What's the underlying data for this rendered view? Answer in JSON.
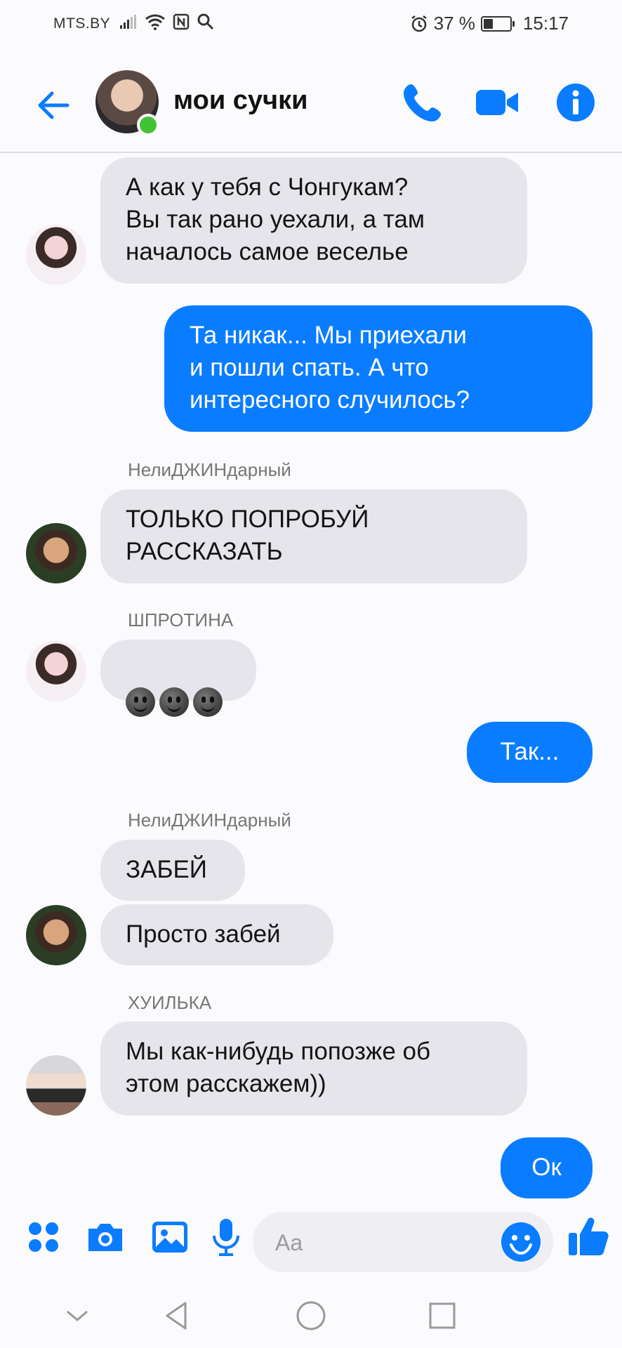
{
  "status_bar": {
    "carrier": "MTS.BY",
    "battery_percent": "37 %",
    "battery_level": 0.37,
    "time": "15:17"
  },
  "header": {
    "title": "мои сучки",
    "back_icon": "back-arrow-icon",
    "call_icon": "phone-icon",
    "video_icon": "video-camera-icon",
    "info_icon": "info-icon"
  },
  "messages": [
    {
      "direction": "in",
      "sender": "",
      "text": "А как у тебя с Чонгукам?\nВы так рано уехали, а там\nначалось самое веселье"
    },
    {
      "direction": "out",
      "text": "Та никак... Мы приехали\nи пошли спать. А что\nинтересного случилось?"
    },
    {
      "direction": "in",
      "sender": "НелиДЖИНдарный",
      "text": "ТОЛЬКО ПОПРОБУЙ\nРАССКАЗАТЬ"
    },
    {
      "direction": "in",
      "sender": "ШПРОТИНА",
      "text": "",
      "emoji": "grinning-face-emoji x3"
    },
    {
      "direction": "out",
      "text": "Так..."
    },
    {
      "direction": "in",
      "sender": "НелиДЖИНдарный",
      "text": "ЗАБЕЙ"
    },
    {
      "direction": "in",
      "sender": "",
      "text": "Просто забей"
    },
    {
      "direction": "in",
      "sender": "ХУИЛЬКА",
      "text": "Мы как-нибудь попозже об\nэтом расскажем))"
    },
    {
      "direction": "out",
      "text": "Ок"
    }
  ],
  "composer": {
    "placeholder": "Aa",
    "icons": [
      "more-apps-icon",
      "camera-icon",
      "gallery-icon",
      "microphone-icon",
      "emoji-icon",
      "thumbs-up-icon"
    ]
  },
  "colors": {
    "accent": "#0a7cff",
    "incoming_bubble": "#e6e5eb",
    "online": "#44c236",
    "background": "#fbfafd"
  }
}
